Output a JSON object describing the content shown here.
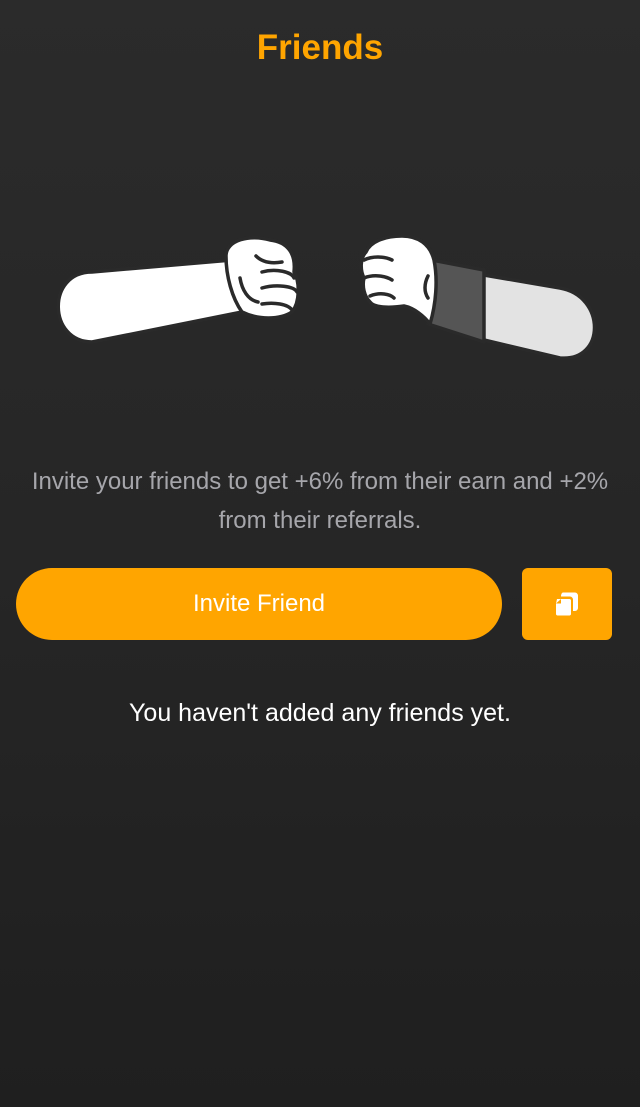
{
  "colors": {
    "accent": "#FFA500",
    "background": "#262626",
    "description_text": "#A6A6AB",
    "primary_text": "#FFFFFF"
  },
  "header": {
    "title": "Friends"
  },
  "illustration": {
    "icon": "fist-bump-illustration"
  },
  "invite": {
    "description": "Invite your friends to get +6% from their earn and +2% from their referrals.",
    "button_label": "Invite Friend",
    "copy_icon": "copy-icon"
  },
  "friends": {
    "empty_message": "You haven't added any friends yet."
  }
}
